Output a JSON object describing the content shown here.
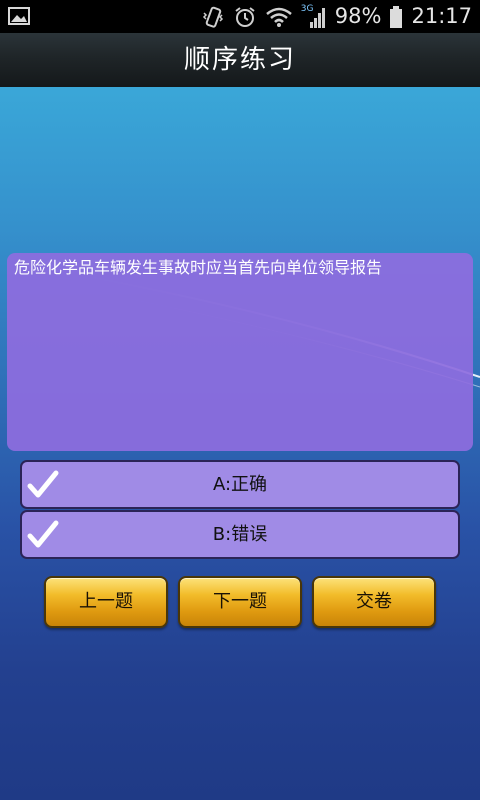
{
  "status_bar": {
    "battery": "98%",
    "time": "21:17",
    "network": "3G",
    "icons": [
      "image-icon",
      "vibrate-icon",
      "alarm-icon",
      "wifi-icon",
      "signal-icon",
      "battery-icon"
    ]
  },
  "header": {
    "title": "顺序练习"
  },
  "question": {
    "text": "危险化学品车辆发生事故时应当首先向单位领导报告"
  },
  "options": [
    {
      "label": "A:正确",
      "icon": "check-icon"
    },
    {
      "label": "B:错误",
      "icon": "check-icon"
    }
  ],
  "buttons": {
    "prev": "上一题",
    "next": "下一题",
    "submit": "交卷"
  },
  "colors": {
    "question_bg": "#8e6dde",
    "option_bg": "#a08be6",
    "button_gold": "#f2bc2a",
    "title_bar": "#1f2528"
  }
}
